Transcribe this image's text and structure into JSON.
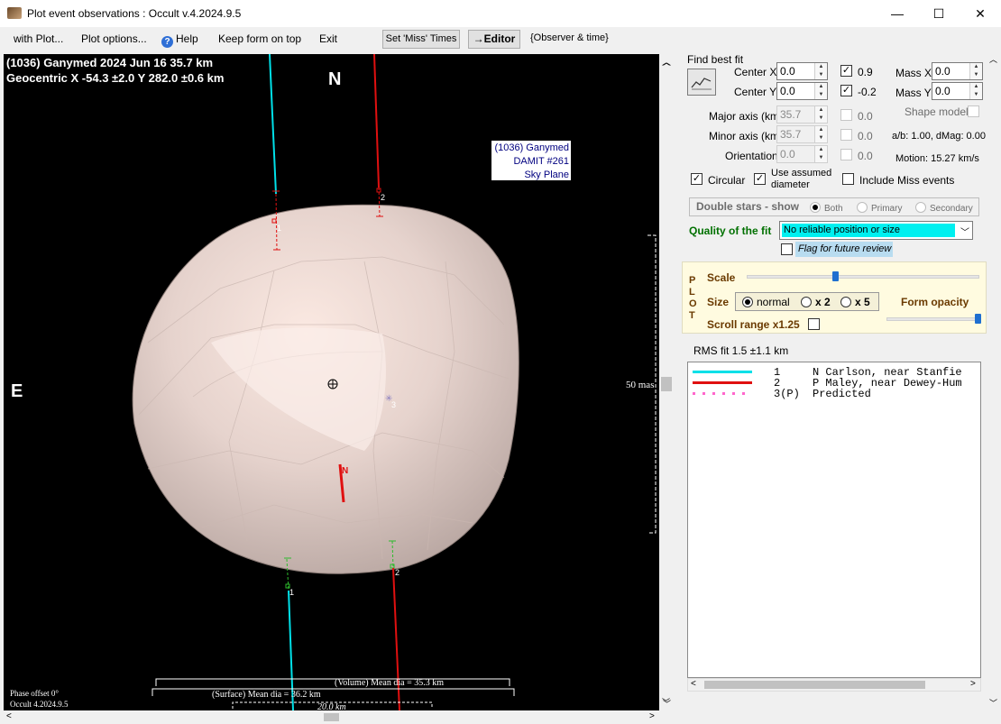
{
  "window": {
    "title": "Plot event observations : Occult v.4.2024.9.5",
    "minimize": "—",
    "maximize": "☐",
    "close": "✕"
  },
  "menu": {
    "with_plot": "with Plot...",
    "plot_options": "Plot options...",
    "help": "Help",
    "keep_on_top": "Keep form on top",
    "exit": "Exit",
    "set_miss_times": "Set 'Miss' Times",
    "editor": "→Editor",
    "observer_time": "{Observer & time}"
  },
  "plot": {
    "header_line1": "(1036) Ganymed  2024 Jun 16   35.7 km",
    "header_line2": "Geocentric  X  -54.3 ±2.0  Y 282.0 ±0.6 km",
    "north": "N",
    "east": "E",
    "info_box": [
      "(1036) Ganymed",
      "DAMIT #261",
      "Sky Plane"
    ],
    "scale_label": "50 mas",
    "volume_dia": "(Volume) Mean dia = 35.3 km",
    "surface_dia": "(Surface) Mean dia = 36.2 km",
    "km_scale": "20.0 km",
    "phase_offset": "Phase offset 0°",
    "version": "Occult 4.2024.9.5",
    "chord_labels": {
      "c1_top": "1",
      "c2_top": "2",
      "c1_bot": "1",
      "c2_bot": "2",
      "predicted": "3",
      "north_arrow": "N"
    },
    "colors": {
      "chord1": "#00e0e8",
      "chord2": "#e01010",
      "predicted": "#ff66cc",
      "shape": "#e8d6d0"
    }
  },
  "panel": {
    "find_best_fit": "Find best fit",
    "center_x_label": "Center X",
    "center_x": "0.0",
    "center_y_label": "Center Y",
    "center_y": "0.0",
    "chk_09": "0.9",
    "chk_m02": "-0.2",
    "mass_x_label": "Mass X",
    "mass_x": "0.0",
    "mass_y_label": "Mass Y",
    "mass_y": "0.0",
    "major_axis_label": "Major axis (km)",
    "major_axis": "35.7",
    "minor_axis_label": "Minor axis (km)",
    "minor_axis": "35.7",
    "orientation_label": "Orientation",
    "orientation": "0.0",
    "dis_val1": "0.0",
    "dis_val2": "0.0",
    "dis_val3": "0.0",
    "shape_model": "Shape model",
    "ab_dmag": "a/b: 1.00, dMag: 0.00",
    "motion": "Motion: 15.27 km/s",
    "circular": "Circular",
    "use_assumed": "Use assumed",
    "diameter": "diameter",
    "include_miss": "Include Miss events",
    "double_stars": "Double stars - show",
    "both": "Both",
    "primary": "Primary",
    "secondary": "Secondary",
    "quality_label": "Quality of the fit",
    "quality_value": "No reliable position or size",
    "flag_review": "Flag for future review",
    "plot_letters": [
      "P",
      "L",
      "O",
      "T"
    ],
    "scale": "Scale",
    "size": "Size",
    "normal": "normal",
    "x2": "x 2",
    "x5": "x 5",
    "form_opacity": "Form opacity",
    "scroll_range": "Scroll range x1.25",
    "rms_fit": "RMS fit 1.5 ±1.1 km",
    "scale_slider_value": 0.38,
    "opacity_slider_value": 1.0
  },
  "legend": [
    {
      "num": "1   ",
      "name": "N Carlson, near Stanfie",
      "color": "#00e0e8",
      "style": "solid"
    },
    {
      "num": "2   ",
      "name": "P Maley, near Dewey-Hum",
      "color": "#e01010",
      "style": "solid"
    },
    {
      "num": "3(P)",
      "name": "Predicted",
      "color": "#ff66cc",
      "style": "dotted"
    }
  ]
}
